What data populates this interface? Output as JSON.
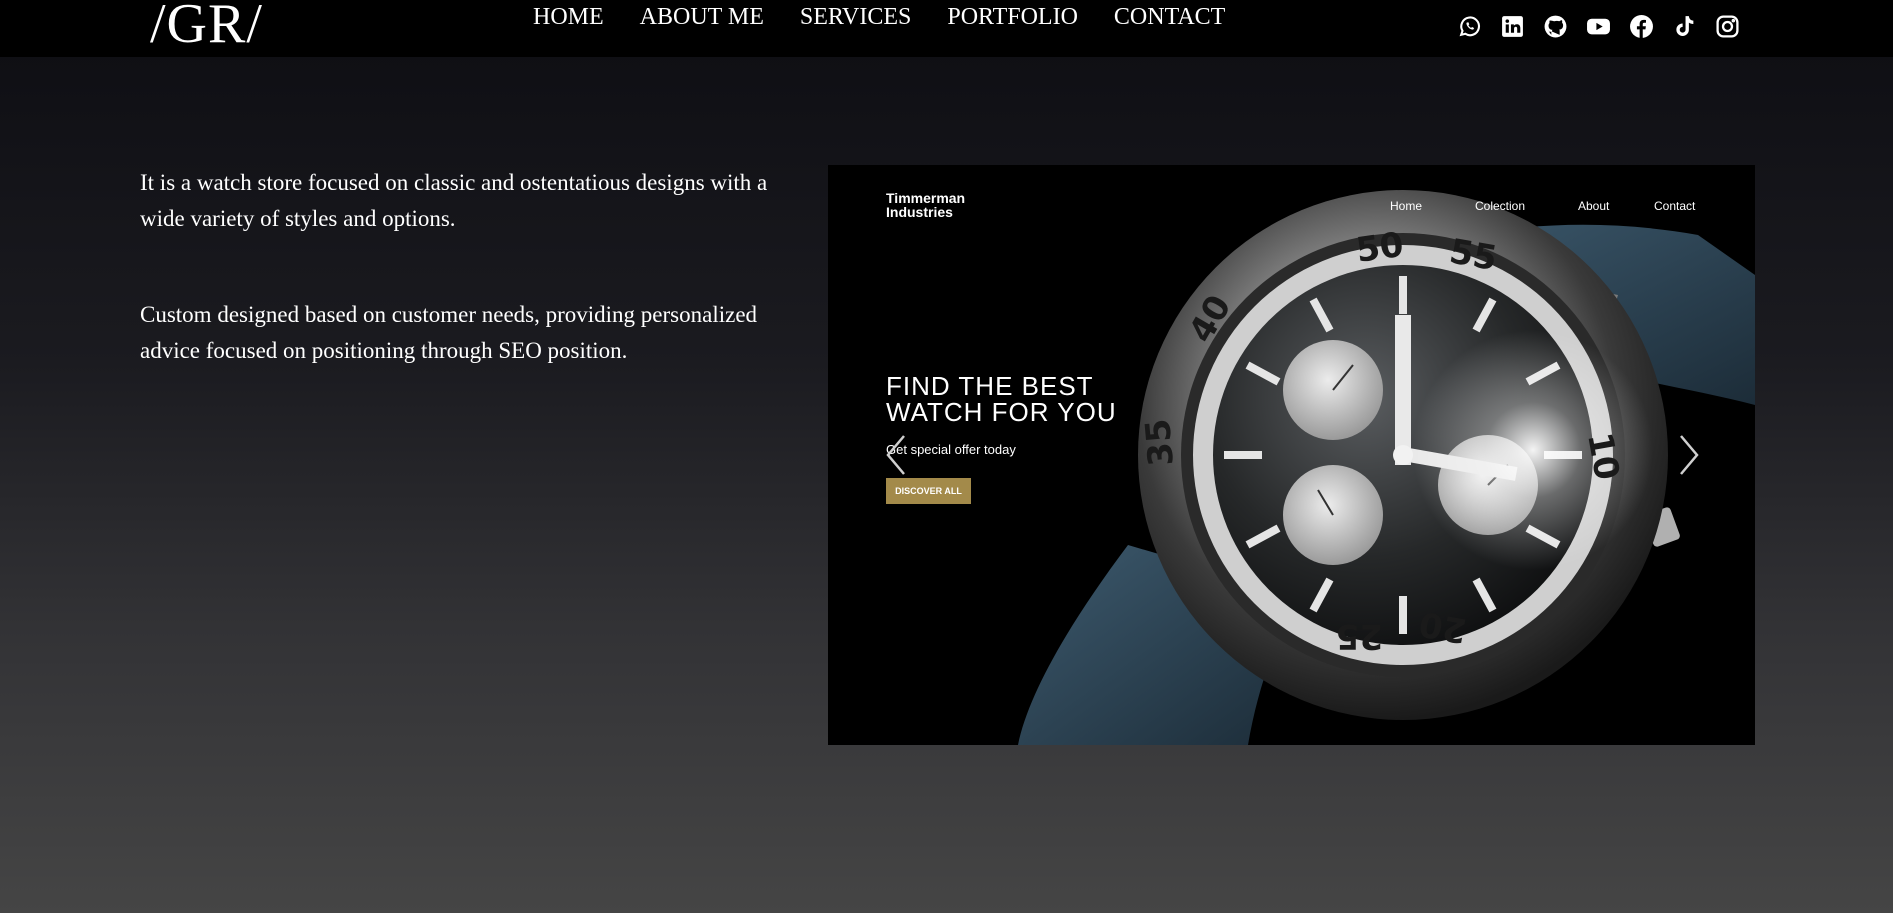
{
  "header": {
    "logo": "/GR/",
    "nav": [
      "HOME",
      "ABOUT ME",
      "SERVICES",
      "PORTFOLIO",
      "CONTACT"
    ],
    "social_icons": [
      "whatsapp-icon",
      "linkedin-icon",
      "github-icon",
      "youtube-icon",
      "facebook-icon",
      "tiktok-icon",
      "instagram-icon"
    ]
  },
  "project": {
    "description_1": "It is a watch store focused on classic and ostentatious designs with a wide variety of styles and options.",
    "description_2": "Custom designed based on customer needs, providing personalized advice focused on positioning through SEO position."
  },
  "preview": {
    "brand": "Timmerman\nIndustries",
    "nav": [
      "Home",
      "Colection",
      "About",
      "Contact"
    ],
    "headline": "FIND THE BEST\nWATCH FOR YOU",
    "subtext": "Get special offer today",
    "button": "DISCOVER ALL",
    "button_color": "#a38a4a"
  },
  "colors": {
    "topbar": "#000000",
    "text": "#ffffff"
  }
}
